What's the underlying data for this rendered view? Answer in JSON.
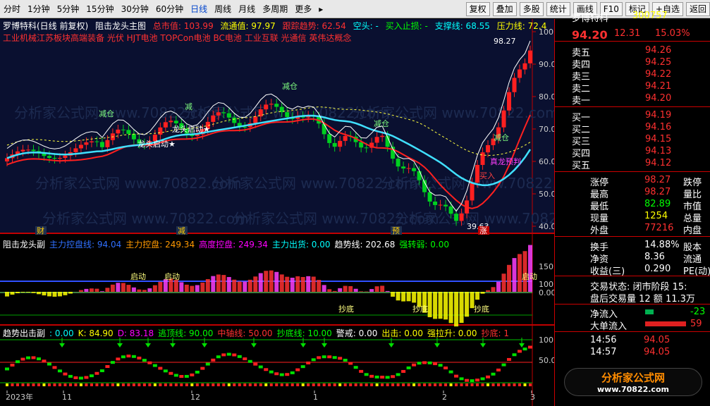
{
  "toolbar": {
    "periods": [
      "分时",
      "1分钟",
      "5分钟",
      "15分钟",
      "30分钟",
      "60分钟",
      "日线",
      "周线",
      "月线",
      "多周期",
      "更多"
    ],
    "active": "日线",
    "buttons": [
      "复权",
      "叠加",
      "多股",
      "统计",
      "画线",
      "F10",
      "标记",
      "+自选",
      "返回"
    ]
  },
  "main_chart": {
    "stock": "罗博特科(日线 前复权)",
    "indicator": "阻击龙头主图",
    "mcap": "总市值: 103.99",
    "float": "流通值: 97.97",
    "trend": "跟踪趋势: 62.54",
    "short": "空头: -",
    "stoploss": "买入止损: -",
    "support": "支撑线: 68.55",
    "pressure": "压力线: 72.4",
    "concepts": "工业机械江苏板块高端装备 光伏 HJT电池 TOPCon电池 BC电池 工业互联 光通信 英伟达概念",
    "y_ticks": [
      "100.00",
      "90.00",
      "80.00",
      "70.00",
      "60.00",
      "50.00",
      "40.00"
    ],
    "high_label": "98.27",
    "low_label": "39.63",
    "annotations": [
      "减仓",
      "龙头启动★",
      "龙头启动★",
      "减",
      "减仓",
      "减仓",
      "减仓",
      "真龙预判",
      "买入"
    ],
    "bottom_tags": [
      "财",
      "减",
      "预",
      "涨"
    ],
    "watermark": "分析家公式网 www.70822.com"
  },
  "sub1": {
    "name": "阻击龙头副",
    "items": [
      "主力控盘线: 94.04",
      "主力控盘: 249.34",
      "高度控盘: 249.34",
      "主力出货: 0.00",
      "趋势线: 202.68",
      "强转弱: 0.00"
    ],
    "y_ticks": [
      "150.00",
      "100.00",
      "0.00"
    ],
    "labels": [
      "启动",
      "启动",
      "抄底",
      "抄底",
      "抄底",
      "启动"
    ]
  },
  "sub2": {
    "name": "趋势出击副",
    "items": [
      ": 0.00",
      "K: 84.90",
      "D: 83.18",
      "逃顶线: 90.00",
      "中轴线: 50.00",
      "抄底线: 10.00",
      "警戒: 0.00",
      "出击: 0.00",
      "强拉升: 0.00",
      "抄底: 1"
    ],
    "y_ticks": [
      "100.00",
      "50.00"
    ],
    "x_labels": [
      "2023年",
      "11",
      "12",
      "1",
      "2",
      "3"
    ]
  },
  "quote": {
    "name": "罗博特科",
    "code": "300757",
    "price": "94.20",
    "change": "12.31",
    "pct": "15.03%",
    "asks": [
      {
        "label": "卖五",
        "price": "94.26",
        "vol": ""
      },
      {
        "label": "卖四",
        "price": "94.25",
        "vol": ""
      },
      {
        "label": "卖三",
        "price": "94.22",
        "vol": ""
      },
      {
        "label": "卖二",
        "price": "94.21",
        "vol": ""
      },
      {
        "label": "卖一",
        "price": "94.20",
        "vol": ""
      }
    ],
    "bids": [
      {
        "label": "买一",
        "price": "94.19",
        "vol": ""
      },
      {
        "label": "买二",
        "price": "94.16",
        "vol": ""
      },
      {
        "label": "买三",
        "price": "94.15",
        "vol": ""
      },
      {
        "label": "买四",
        "price": "94.13",
        "vol": ""
      },
      {
        "label": "买五",
        "price": "94.12",
        "vol": ""
      }
    ],
    "stats": [
      {
        "k": "涨停",
        "v": "98.27",
        "k2": "跌停"
      },
      {
        "k": "最高",
        "v": "98.27",
        "k2": "量比"
      },
      {
        "k": "最低",
        "v": "82.89",
        "k2": "市值"
      },
      {
        "k": "现量",
        "v": "1254",
        "k2": "总量"
      },
      {
        "k": "外盘",
        "v": "77216",
        "k2": "内盘"
      }
    ],
    "stats2": [
      {
        "k": "换手",
        "v": "14.88%",
        "k2": "股本"
      },
      {
        "k": "净资",
        "v": "8.36",
        "k2": "流通"
      },
      {
        "k": "收益(三)",
        "v": "0.290",
        "k2": "PE(动)"
      }
    ],
    "trade_state": "交易状态: 闭市阶段 15:",
    "after_hours": "盘后交易量 12 额 11.3万",
    "net_in": "净流入",
    "net_in_val": "-23",
    "big_in": "大单流入",
    "big_in_val": "59",
    "ticks": [
      {
        "time": "14:56",
        "price": "94.05"
      },
      {
        "time": "14:57",
        "price": "94.05"
      }
    ],
    "logo": "分析家公式网",
    "logo_url": "www.70822.com"
  }
}
